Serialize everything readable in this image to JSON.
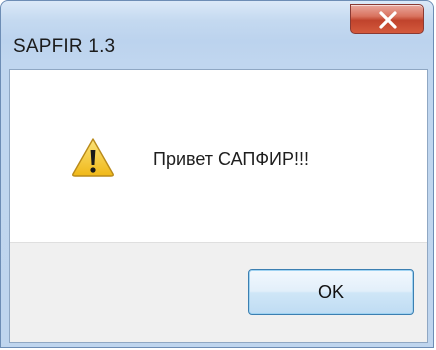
{
  "window": {
    "title": "SAPFIR 1.3"
  },
  "message": {
    "text": "Привет САПФИР!!!",
    "icon": "warning-icon"
  },
  "buttons": {
    "ok_label": "OK",
    "close_icon": "close-icon"
  },
  "colors": {
    "title_bar": "#c4d9f0",
    "close_button": "#c8503a",
    "footer": "#f0f0f0",
    "ok_border": "#3c7fb1",
    "warning_yellow": "#f5c52c"
  }
}
